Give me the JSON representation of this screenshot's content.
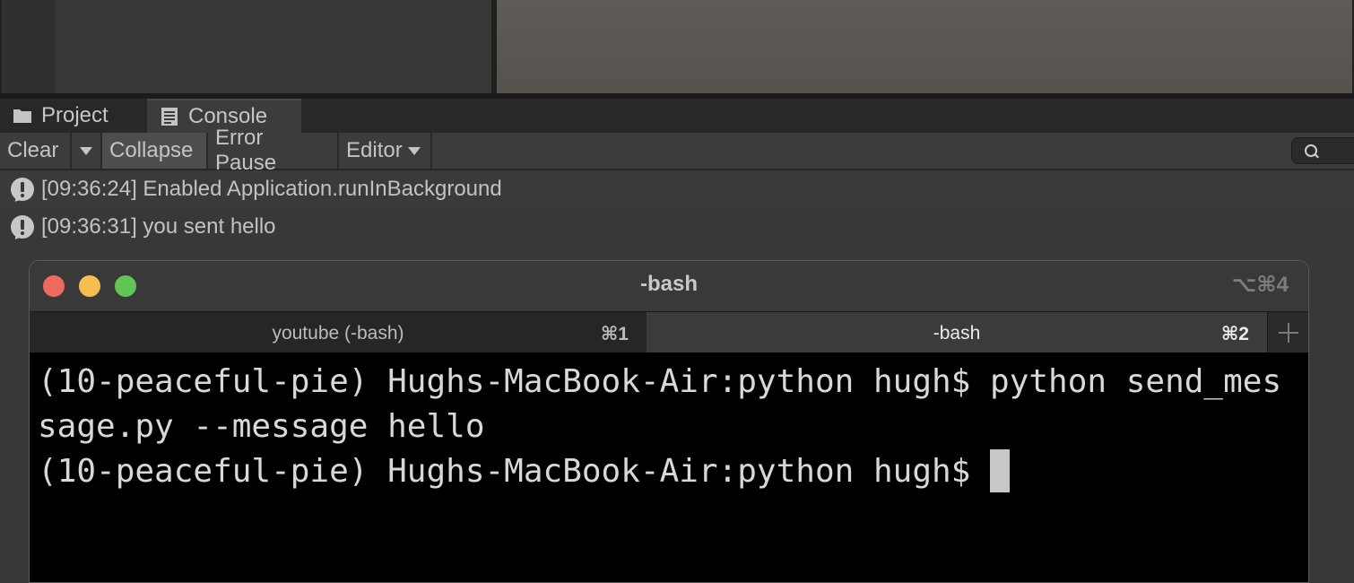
{
  "unity": {
    "tabs": [
      {
        "label": "Project",
        "icon": "folder-icon"
      },
      {
        "label": "Console",
        "icon": "console-icon",
        "active": true
      }
    ],
    "toolbar": {
      "clear_label": "Clear",
      "collapse_label": "Collapse",
      "error_pause_label": "Error Pause",
      "editor_label": "Editor"
    },
    "logs": [
      {
        "text": "[09:36:24] Enabled Application.runInBackground",
        "icon": "warning-icon"
      },
      {
        "text": "[09:36:31] you sent hello",
        "icon": "warning-icon"
      }
    ]
  },
  "terminal": {
    "title": "-bash",
    "shortcut": "⌥⌘4",
    "tabs": [
      {
        "label": "youtube (-bash)",
        "key": "⌘1"
      },
      {
        "label": "-bash",
        "key": "⌘2",
        "active": true
      }
    ],
    "lines": [
      "(10-peaceful-pie) Hughs-MacBook-Air:python hugh$ python send_mes",
      "sage.py --message hello",
      "(10-peaceful-pie) Hughs-MacBook-Air:python hugh$ "
    ]
  },
  "colors": {
    "close": "#ed6a5e",
    "minimize": "#f5bf4f",
    "zoom": "#61c554"
  }
}
